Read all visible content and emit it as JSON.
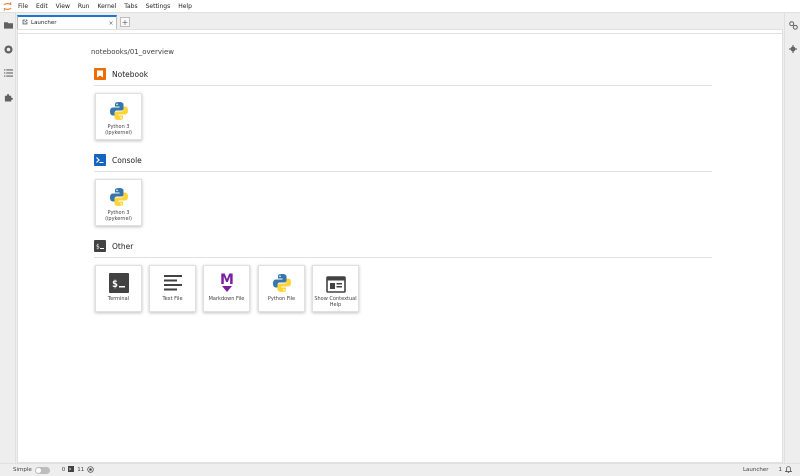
{
  "menubar": {
    "items": [
      "File",
      "Edit",
      "View",
      "Run",
      "Kernel",
      "Tabs",
      "Settings",
      "Help"
    ]
  },
  "tabs": {
    "active": {
      "label": "Launcher"
    },
    "add_label": "+"
  },
  "launcher": {
    "cwd": "notebooks/01_overview",
    "sections": {
      "notebook": {
        "title": "Notebook",
        "cards": [
          {
            "label": "Python 3 (ipykernel)"
          }
        ]
      },
      "console": {
        "title": "Console",
        "cards": [
          {
            "label": "Python 3 (ipykernel)"
          }
        ]
      },
      "other": {
        "title": "Other",
        "cards": [
          {
            "label": "Terminal"
          },
          {
            "label": "Text File"
          },
          {
            "label": "Markdown File"
          },
          {
            "label": "Python File"
          },
          {
            "label": "Show Contextual Help"
          }
        ]
      }
    }
  },
  "statusbar": {
    "simple_label": "Simple",
    "terminals_count": "0",
    "kernels_count": "11",
    "mode_label": "Launcher",
    "notifications_count": "1"
  },
  "colors": {
    "accent": "#1976d2",
    "notebook_icon": "#ef6c00",
    "console_icon": "#1565c0",
    "other_icon": "#424242",
    "markdown_icon": "#7b1fa2"
  }
}
